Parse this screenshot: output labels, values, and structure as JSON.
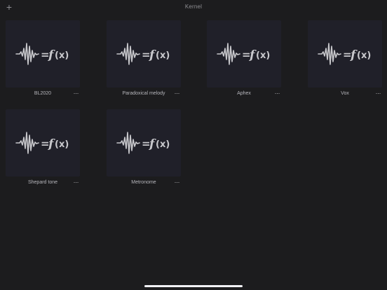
{
  "header": {
    "title": "Kernel",
    "add_icon": "plus-icon"
  },
  "thumbnail_icon": "waveform-fx-icon",
  "thumbnail_text": "= f(x)",
  "more_icon": "ellipsis-icon",
  "more_label": "···",
  "items": [
    {
      "label": "BL2020"
    },
    {
      "label": "Paradoxical melody"
    },
    {
      "label": "Aphex"
    },
    {
      "label": "Vox"
    },
    {
      "label": "Shepard tone"
    },
    {
      "label": "Metronome"
    }
  ],
  "colors": {
    "background": "#1c1c1e",
    "card": "#202029",
    "text": "#b6b6bc",
    "icon": "#c8c8cc"
  }
}
